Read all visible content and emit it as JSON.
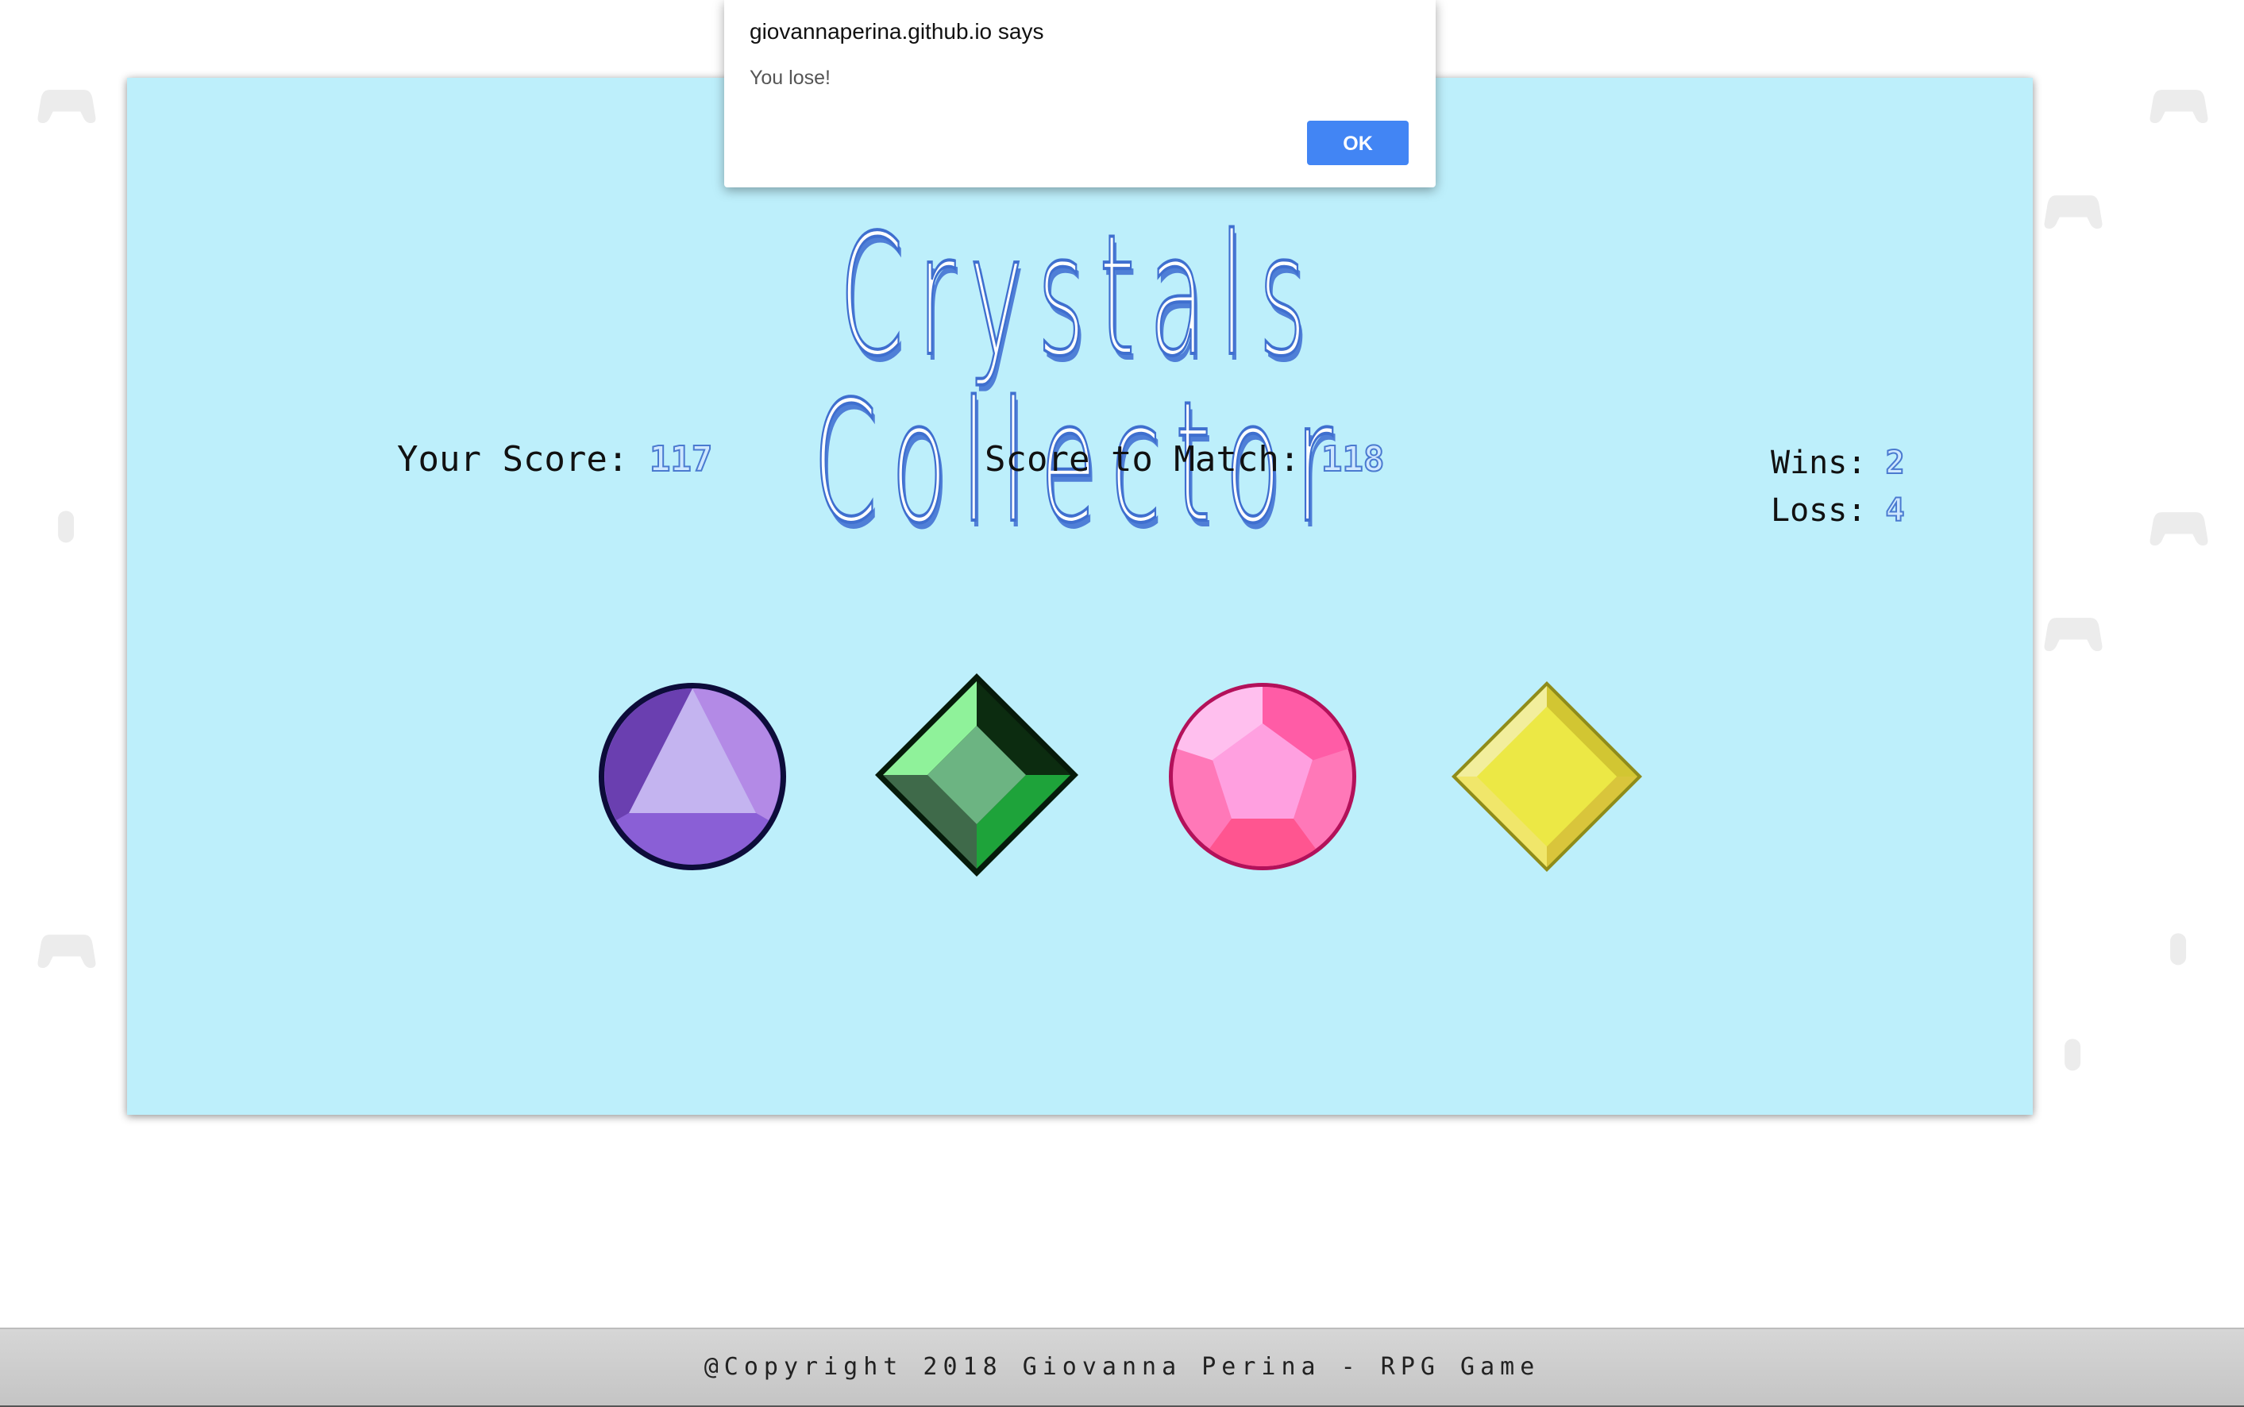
{
  "background": {
    "pattern_icons": [
      "gamepad-icon",
      "mouse-icon"
    ],
    "panel_color": "#bdeffb"
  },
  "game": {
    "title": "Crystals Collector",
    "score_label": "Your Score: ",
    "score_value": "117",
    "target_label": "Score to Match: ",
    "target_value": "118",
    "wins_label": "Wins: ",
    "wins_value": "2",
    "loss_label": "Loss: ",
    "loss_value": "4",
    "crystals": [
      {
        "name": "purple-crystal",
        "color": "#8a5fd6"
      },
      {
        "name": "green-crystal",
        "color": "#1ea33a"
      },
      {
        "name": "pink-crystal",
        "color": "#ff78b8"
      },
      {
        "name": "yellow-crystal",
        "color": "#ece845"
      }
    ]
  },
  "footer": {
    "text": "@Copyright 2018 Giovanna Perina - RPG Game"
  },
  "alert": {
    "title": "giovannaperina.github.io says",
    "message": "You lose!",
    "ok_label": "OK"
  }
}
